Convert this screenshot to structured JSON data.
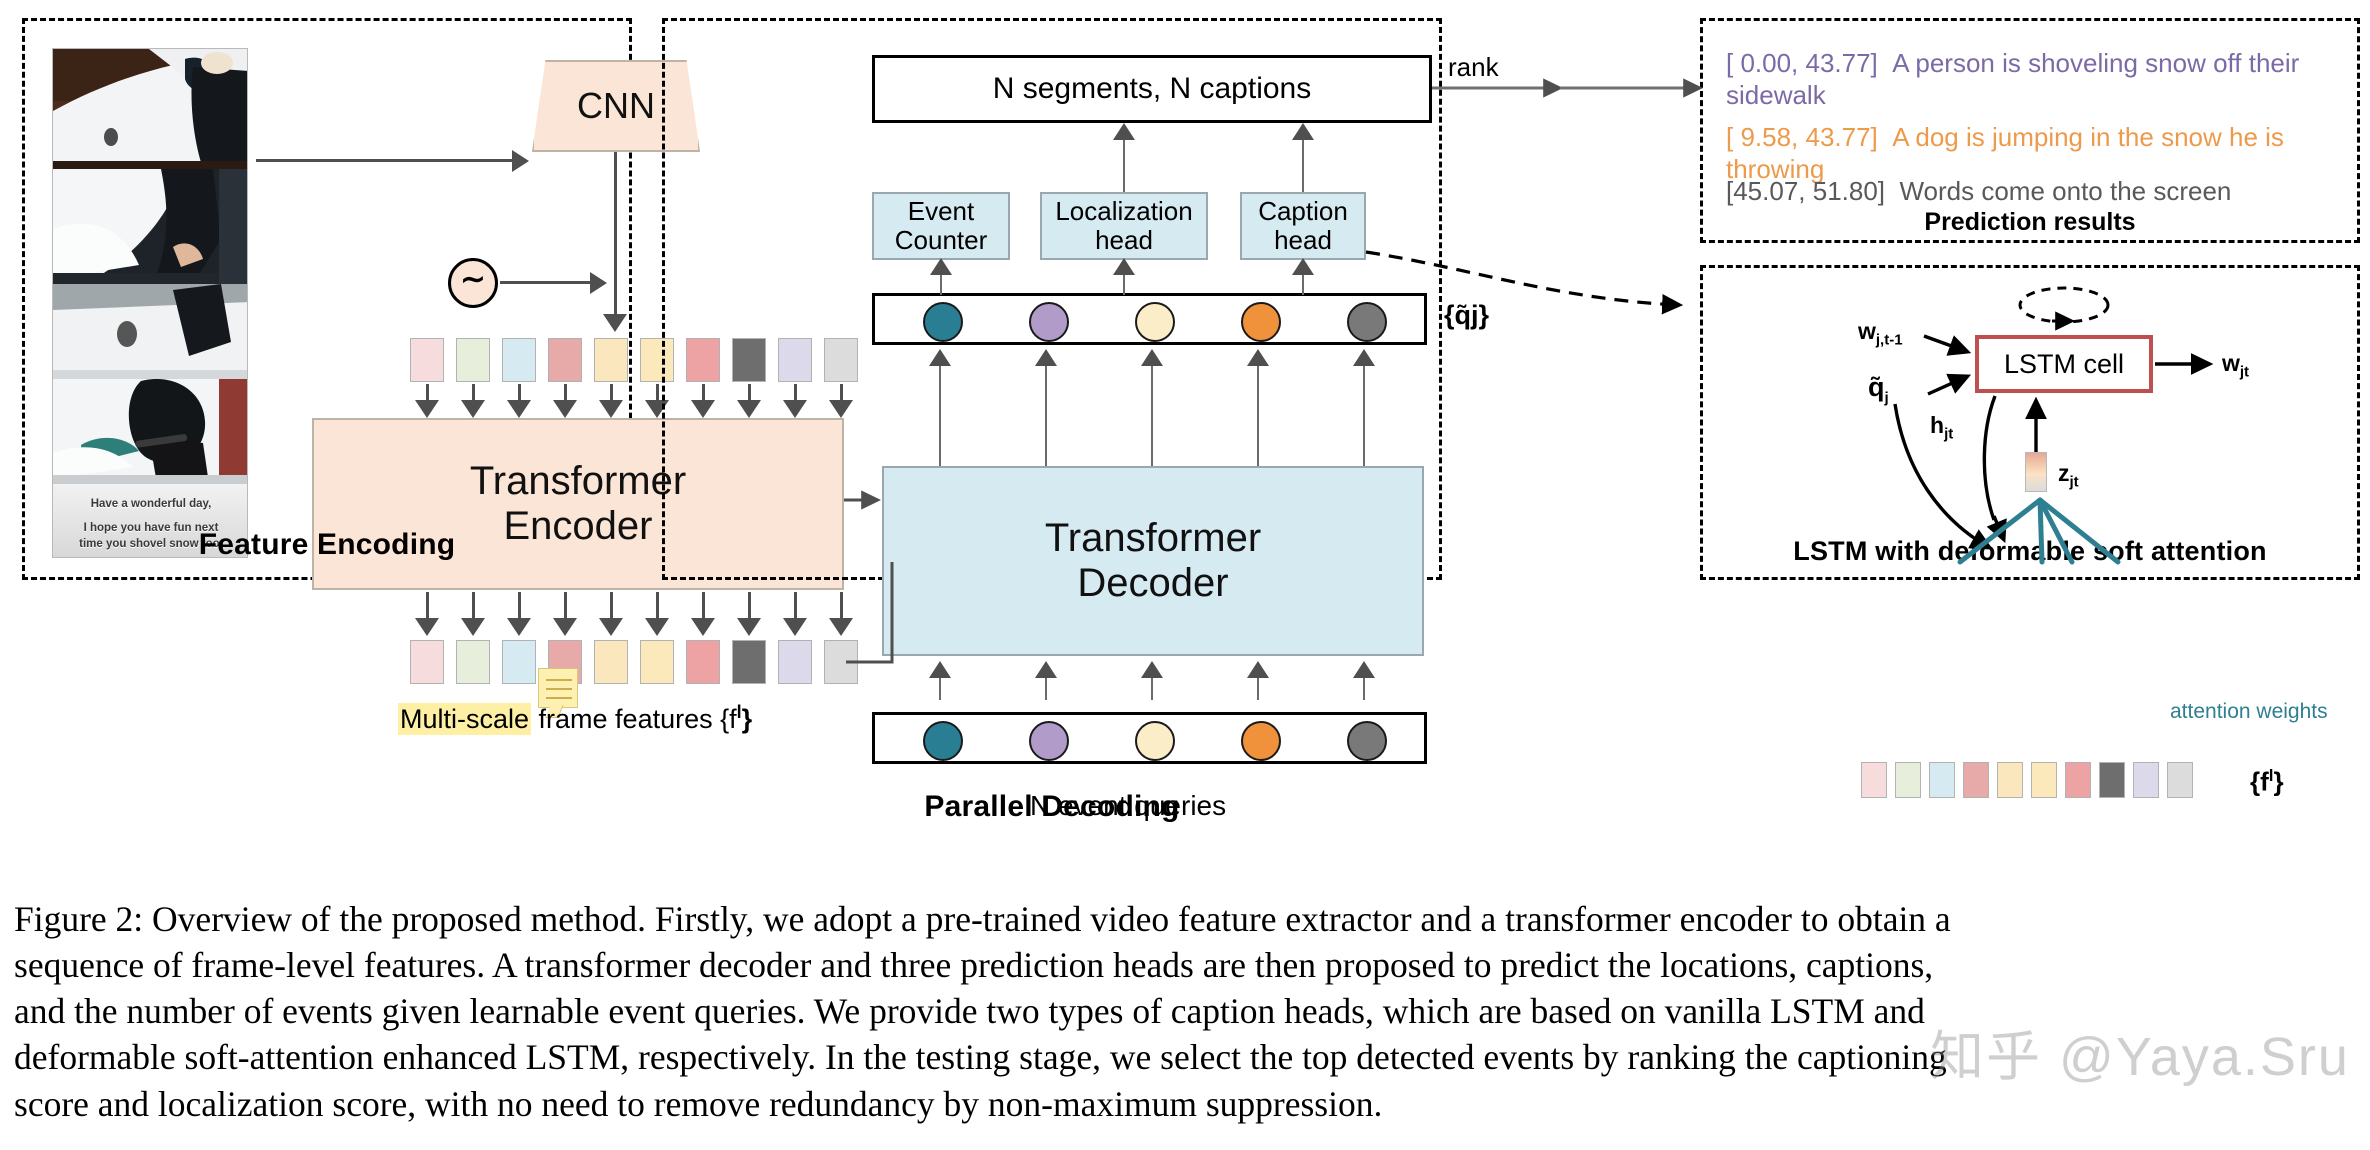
{
  "figure": {
    "panels": {
      "encoding": {
        "caption": "Feature Encoding"
      },
      "decoding": {
        "caption": "Parallel Decoding"
      },
      "prediction": {
        "caption": "Prediction results"
      },
      "lstm": {
        "caption": "LSTM with deformable soft attention"
      }
    },
    "encoding": {
      "cnn_label": "CNN",
      "positional_encoding_symbol": "∼",
      "encoder_label_line1": "Transformer",
      "encoder_label_line2": "Encoder",
      "features_label_highlight": "Multi-scale",
      "features_label_rest": " frame features {f",
      "features_label_sup": "l",
      "features_label_end": "}",
      "video_subtitles": [
        "Have a wonderful day,",
        "I hope you have fun next",
        "time you shovel snow too."
      ],
      "feature_colors": [
        "#f6dcdc",
        "#e7eedc",
        "#d6eaf2",
        "#e8a9a9",
        "#fae7bd",
        "#fbe8bb",
        "#eda3a3",
        "#6e6e6e",
        "#dcd9ea",
        "#dcdcdc"
      ]
    },
    "decoding": {
      "output_box_label": "N segments, N captions",
      "rank_label": "rank",
      "heads": [
        {
          "line1": "Event",
          "line2": "Counter"
        },
        {
          "line1": "Localization",
          "line2": "head"
        },
        {
          "line1": "Caption",
          "line2": "head"
        }
      ],
      "decoder_label_line1": "Transformer",
      "decoder_label_line2": "Decoder",
      "qtilde_label": "{q̃j}",
      "queries_label": "N event queries",
      "query_colors": [
        "#2a7e94",
        "#b09bc9",
        "#fbedc8",
        "#f0913c",
        "#797979"
      ]
    },
    "prediction": {
      "entries": [
        {
          "time": "[ 0.00, 43.77]",
          "text": "A person is shoveling snow off their sidewalk",
          "color": "#7b6aa8"
        },
        {
          "time": "[ 9.58, 43.77]",
          "text": "A dog is jumping in the snow he is throwing",
          "color": "#ee9a4b"
        },
        {
          "time": "[45.07, 51.80]",
          "text": "Words come onto the screen",
          "color": "#595959"
        }
      ]
    },
    "lstm": {
      "cell_label": "LSTM cell",
      "input_prev_word": "w",
      "input_prev_word_sub": "j,t-1",
      "input_query": "q̃",
      "input_query_sub": "j",
      "output_word": "w",
      "output_word_sub": "jt",
      "hidden_state": "h",
      "hidden_state_sub": "jt",
      "context": "z",
      "context_sub": "jt",
      "attention_label": "attention weights",
      "features_label": "{f",
      "features_label_sup": "l",
      "features_label_end": "}",
      "attention_color": "#2e7f92",
      "cell_border_color": "#c0504d",
      "feature_colors": [
        "#f6dcdc",
        "#e7eedc",
        "#d6eaf2",
        "#e8a9a9",
        "#fae7bd",
        "#fbe8bb",
        "#eda3a3",
        "#6e6e6e",
        "#dcd9ea",
        "#dcdcdc"
      ]
    }
  },
  "caption": {
    "lines": [
      "Figure 2: Overview of the proposed method.  Firstly, we adopt a pre-trained video feature extractor and a transformer encoder to obtain a",
      "sequence of frame-level features.  A transformer decoder and three prediction heads are then proposed to predict the locations, captions,",
      "and the number of events given learnable event queries.  We provide two types of caption heads, which are based on vanilla LSTM and",
      "deformable soft-attention enhanced LSTM, respectively.  In the testing stage, we select the top detected events by ranking the captioning",
      "score and localization score, with no need to remove redundancy by non-maximum suppression."
    ]
  },
  "watermark": {
    "text": "知乎 @Yaya.Sru"
  }
}
